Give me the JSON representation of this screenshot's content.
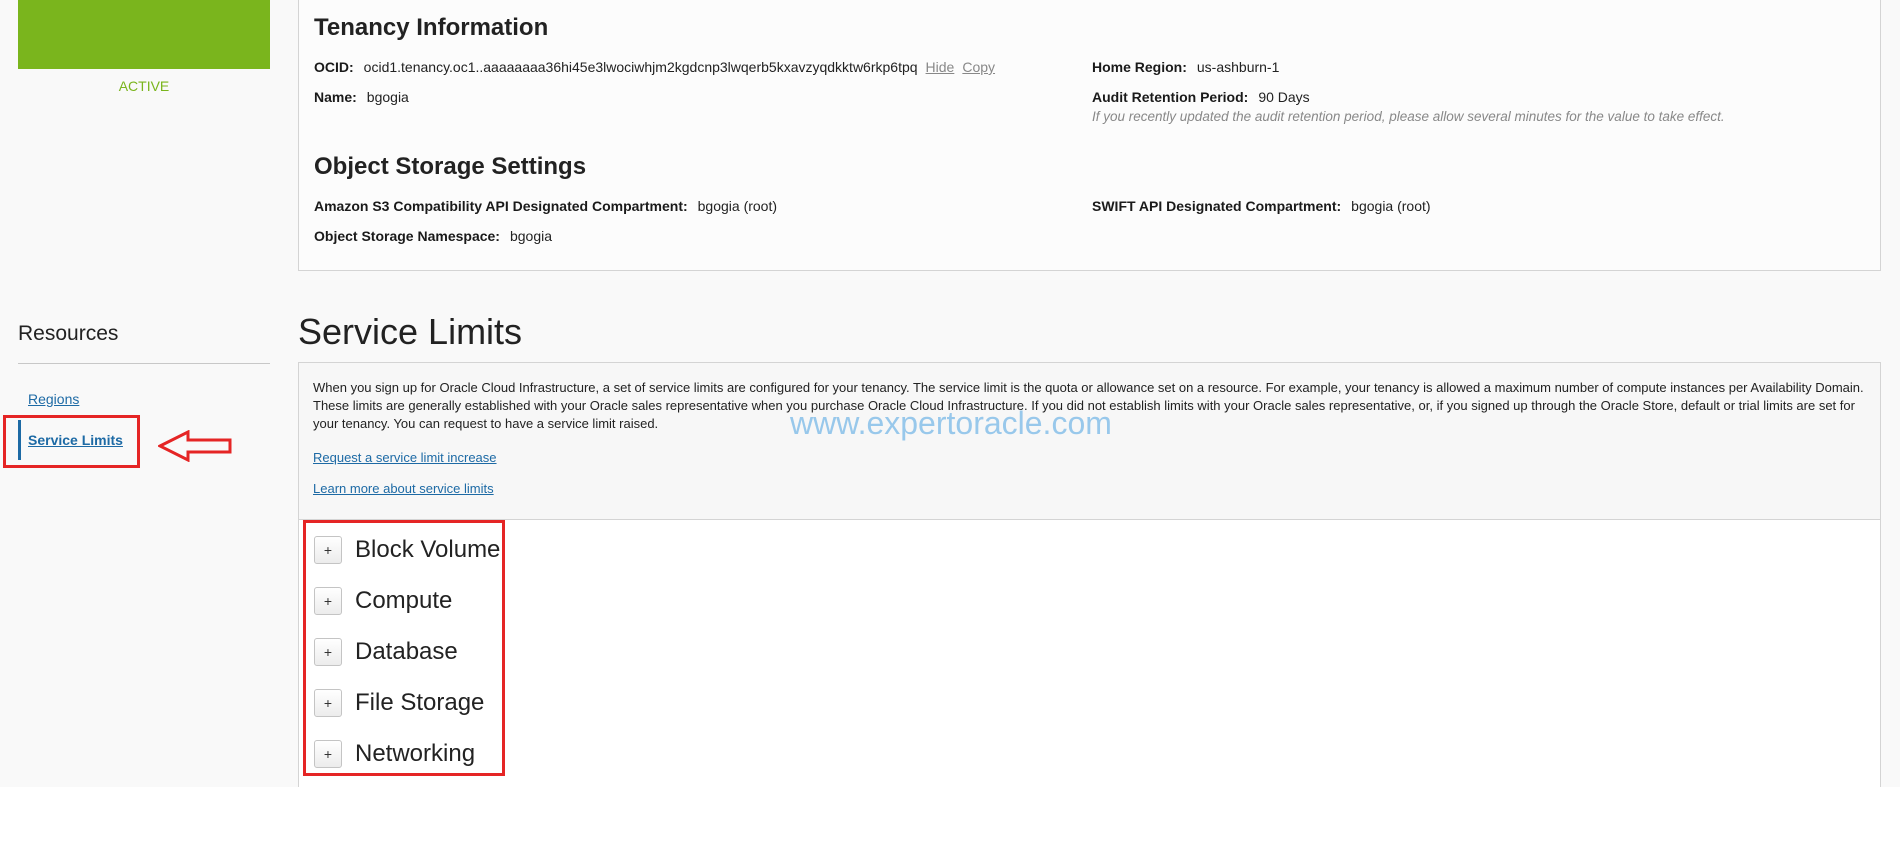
{
  "sidebar": {
    "status": "ACTIVE",
    "resources_title": "Resources",
    "items": [
      {
        "label": "Regions"
      },
      {
        "label": "Service Limits"
      }
    ]
  },
  "tenancy": {
    "title": "Tenancy Information",
    "ocid_label": "OCID:",
    "ocid_value": "ocid1.tenancy.oc1..aaaaaaaa36hi45e3lwociwhjm2kgdcnp3lwqerb5kxavzyqdkktw6rkp6tpq",
    "hide_link": "Hide",
    "copy_link": "Copy",
    "name_label": "Name:",
    "name_value": "bgogia",
    "home_region_label": "Home Region:",
    "home_region_value": "us-ashburn-1",
    "audit_label": "Audit Retention Period:",
    "audit_value": "90 Days",
    "audit_note": "If you recently updated the audit retention period, please allow several minutes for the value to take effect."
  },
  "object_storage": {
    "title": "Object Storage Settings",
    "s3_label": "Amazon S3 Compatibility API Designated Compartment:",
    "s3_value": "bgogia (root)",
    "swift_label": "SWIFT API Designated Compartment:",
    "swift_value": "bgogia (root)",
    "namespace_label": "Object Storage Namespace:",
    "namespace_value": "bgogia"
  },
  "service_limits": {
    "title": "Service Limits",
    "intro": "When you sign up for Oracle Cloud Infrastructure, a set of service limits are configured for your tenancy. The service limit is the quota or allowance set on a resource. For example, your tenancy is allowed a maximum number of compute instances per Availability Domain. These limits are generally established with your Oracle sales representative when you purchase Oracle Cloud Infrastructure. If you did not establish limits with your Oracle sales representative, or, if you signed up through the Oracle Store, default or trial limits are set for your tenancy. You can request to have a service limit raised.",
    "request_link": "Request a service limit increase",
    "learn_link": "Learn more about service limits",
    "expand_symbol": "+",
    "categories": [
      "Block Volume",
      "Compute",
      "Database",
      "File Storage",
      "Networking"
    ]
  },
  "watermark": "www.expertoracle.com",
  "colors": {
    "accent": "#1d6aa5",
    "status_green": "#7ab51d",
    "annotation_red": "#e52525",
    "watermark": "#8ec3ea"
  }
}
